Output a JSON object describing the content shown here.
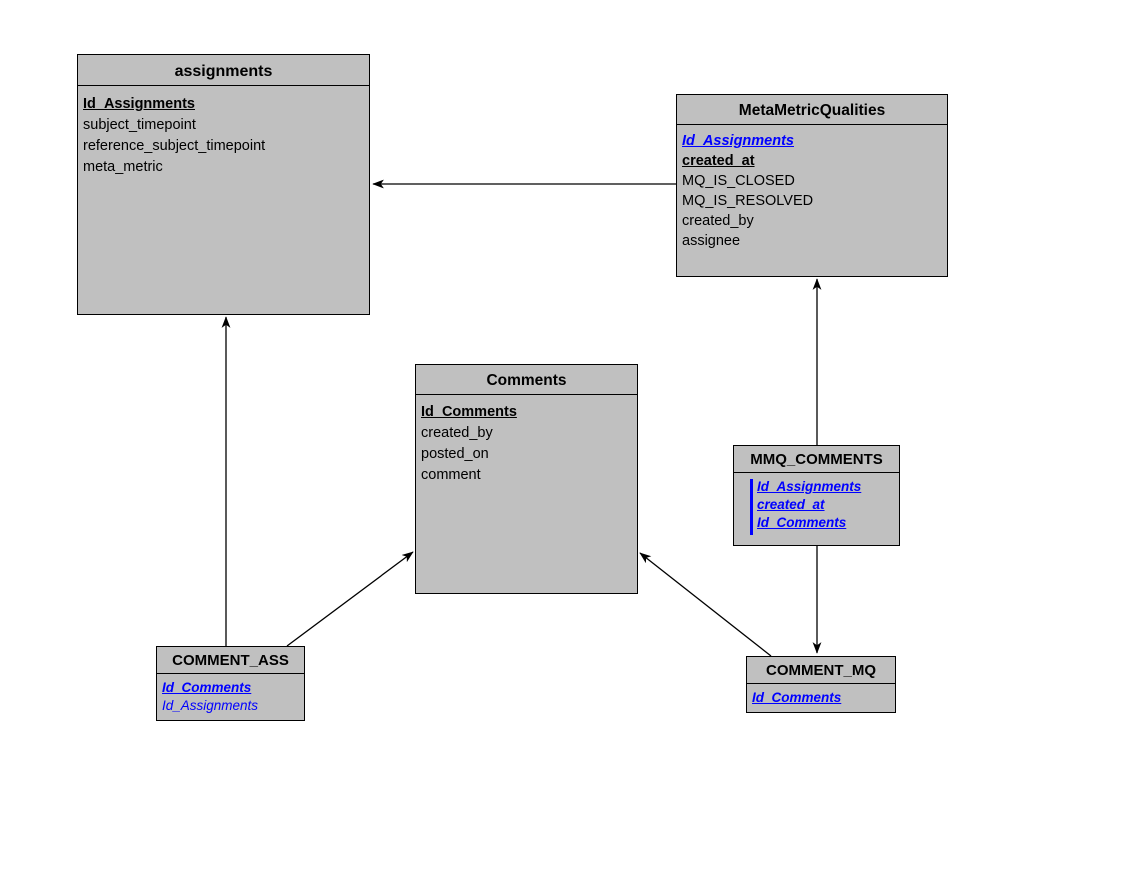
{
  "diagram": {
    "type": "entity-relationship-diagram",
    "background_color": "#ffffff",
    "entity_fill_color": "#c0c0c0",
    "entity_border_color": "#000000",
    "foreign_key_color": "#0000ff",
    "primary_key_color": "#000000"
  },
  "entities": {
    "assignments": {
      "title": "assignments",
      "fields": [
        {
          "name": "Id_Assignments",
          "role": "pk"
        },
        {
          "name": "subject_timepoint",
          "role": "attr"
        },
        {
          "name": "reference_subject_timepoint",
          "role": "attr"
        },
        {
          "name": "meta_metric",
          "role": "attr"
        }
      ]
    },
    "metametricqualities": {
      "title": "MetaMetricQualities",
      "fields": [
        {
          "name": "Id_Assignments",
          "role": "fk"
        },
        {
          "name": "created_at",
          "role": "pk"
        },
        {
          "name": "MQ_IS_CLOSED",
          "role": "attr"
        },
        {
          "name": "MQ_IS_RESOLVED",
          "role": "attr"
        },
        {
          "name": "created_by",
          "role": "attr"
        },
        {
          "name": "assignee",
          "role": "attr"
        }
      ]
    },
    "comments": {
      "title": "Comments",
      "fields": [
        {
          "name": "Id_Comments",
          "role": "pk"
        },
        {
          "name": "created_by",
          "role": "attr"
        },
        {
          "name": "posted_on",
          "role": "attr"
        },
        {
          "name": "comment",
          "role": "attr"
        }
      ]
    },
    "mmq_comments": {
      "title": "MMQ_COMMENTS",
      "fields": [
        {
          "name": "Id_Assignments",
          "role": "fk"
        },
        {
          "name": "created_at",
          "role": "fk"
        },
        {
          "name": "Id_Comments",
          "role": "fk"
        }
      ]
    },
    "comment_ass": {
      "title": "COMMENT_ASS",
      "fields": [
        {
          "name": "Id_Comments",
          "role": "fk"
        },
        {
          "name": "Id_Assignments",
          "role": "fk-plain"
        }
      ]
    },
    "comment_mq": {
      "title": "COMMENT_MQ",
      "fields": [
        {
          "name": "Id_Comments",
          "role": "fk"
        }
      ]
    }
  },
  "relationships": [
    {
      "name": "mmq-to-assignments",
      "from": "metametricqualities",
      "to": "assignments",
      "style": "straight-horizontal"
    },
    {
      "name": "commentass-to-assignments",
      "from": "comment_ass",
      "to": "assignments",
      "style": "straight-vertical"
    },
    {
      "name": "mmqcomments-to-mmq",
      "from": "mmq_comments",
      "to": "metametricqualities",
      "style": "straight-vertical"
    },
    {
      "name": "mmqcomments-to-commentmq",
      "from": "mmq_comments",
      "to": "comment_mq",
      "style": "straight-vertical"
    },
    {
      "name": "commentass-to-comments",
      "from": "comment_ass",
      "to": "comments",
      "style": "diagonal"
    },
    {
      "name": "commentmq-to-comments",
      "from": "comment_mq",
      "to": "comments",
      "style": "diagonal"
    }
  ]
}
